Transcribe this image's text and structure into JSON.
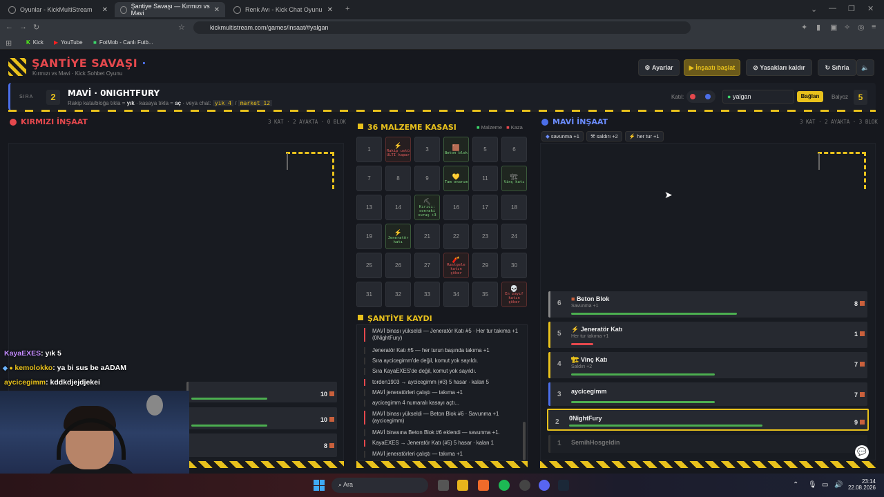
{
  "browser": {
    "tabs": [
      {
        "title": "Oyunlar - KickMultiStream",
        "active": false
      },
      {
        "title": "Şantiye Savaşı — Kırmızı vs Mavi",
        "active": true
      },
      {
        "title": "Renk Avı - Kick Chat Oyunu",
        "active": false
      }
    ],
    "url": "kickmultistream.com/games/insaat/#yalgan",
    "bookmarks": [
      "Kick",
      "YouTube",
      "FotMob - Canlı Futb..."
    ]
  },
  "header": {
    "title": "ŞANTİYE SAVAŞI",
    "subtitle": "Kırmızı vs Mavi · Kick Sohbet Oyunu",
    "buttons": {
      "settings": "Ayarlar",
      "start": "İnşaatı başlat",
      "unban": "Yasakları kaldır",
      "reset": "Sıfırla"
    }
  },
  "turn": {
    "label": "SIRA",
    "number": "2",
    "team_player": "MAVİ · 0NIGHTFURY",
    "hint_pre": "Rakip kata/bloğa tıkla = ",
    "hint_yik": "yık",
    "hint_mid": " · kasaya tıkla = ",
    "hint_ac": "aç",
    "hint_post": " · veya chat: ",
    "cmd1": "yık 4",
    "sep": "/",
    "cmd2": "market 12",
    "kat_label": "Katıl:",
    "channel_value": "yalgan",
    "connect": "Bağlan",
    "balyoz_label": "Balyoz",
    "balyoz_value": "5"
  },
  "red": {
    "title": "KIRMIZI İNŞAAT",
    "stats": "3 KAT · 2 AYAKTA · 0 BLOK",
    "floors": [
      {
        "value": "10"
      },
      {
        "value": "10"
      },
      {
        "value": "8"
      }
    ]
  },
  "blue": {
    "title": "MAVİ İNŞAAT",
    "stats": "3 KAT · 2 AYAKTA · 3 BLOK",
    "buffs": [
      "savunma +1",
      "saldırı +2",
      "her tur +1"
    ],
    "floors": [
      {
        "n": "6",
        "name": "Beton Blok",
        "sub": "Savunma +1",
        "value": "8",
        "fill": 0.6
      },
      {
        "n": "5",
        "name": "Jeneratör Katı",
        "sub": "Her tur takıma +1",
        "value": "1",
        "fill": 0.08
      },
      {
        "n": "4",
        "name": "Vinç Katı",
        "sub": "Saldırı +2",
        "value": "7",
        "fill": 0.52
      },
      {
        "n": "3",
        "name": "aycicegimm",
        "sub": "",
        "value": "7",
        "fill": 0.52
      },
      {
        "n": "2",
        "name": "0NightFury",
        "sub": "",
        "value": "9",
        "fill": 0.7
      },
      {
        "n": "1",
        "name": "SemihHosgeldin",
        "sub": "",
        "value": "",
        "fill": 0
      }
    ]
  },
  "crates": {
    "title": "36 MALZEME KASASI",
    "legend_material": "Malzeme",
    "legend_accident": "Kaza",
    "cells": [
      {
        "label": "1"
      },
      {
        "icon": "⚡",
        "label": "Rakip ustü ULTI kapar",
        "kind": "kaza"
      },
      {
        "label": "3"
      },
      {
        "icon": "🟫",
        "label": "Beton blok",
        "kind": "rev"
      },
      {
        "label": "5"
      },
      {
        "label": "6"
      },
      {
        "label": "7"
      },
      {
        "label": "8"
      },
      {
        "label": "9"
      },
      {
        "icon": "💛",
        "label": "Tam onarım",
        "kind": "rev"
      },
      {
        "label": "11"
      },
      {
        "icon": "🏗",
        "label": "Vinç katı",
        "kind": "rev"
      },
      {
        "label": "13"
      },
      {
        "label": "14"
      },
      {
        "icon": "⛏",
        "label": "Kırıcı: sonraki vuruş +3",
        "kind": "rev"
      },
      {
        "label": "16"
      },
      {
        "label": "17"
      },
      {
        "label": "18"
      },
      {
        "label": "19"
      },
      {
        "icon": "⚡",
        "label": "Jeneratör katı",
        "kind": "rev"
      },
      {
        "label": "21"
      },
      {
        "label": "22"
      },
      {
        "label": "23"
      },
      {
        "label": "24"
      },
      {
        "label": "25"
      },
      {
        "label": "26"
      },
      {
        "label": "27"
      },
      {
        "icon": "🧨",
        "label": "Rastgele katın çöker",
        "kind": "kaza"
      },
      {
        "label": "29"
      },
      {
        "label": "30"
      },
      {
        "label": "31"
      },
      {
        "label": "32"
      },
      {
        "label": "33"
      },
      {
        "label": "34"
      },
      {
        "label": "35"
      },
      {
        "icon": "💀",
        "label": "En zayıf katın çöker",
        "kind": "kaza"
      }
    ]
  },
  "log": {
    "title": "ŞANTİYE KAYDI",
    "lines": [
      "MAVİ binası yükseldi — Jeneratör Katı #5 · Her tur takıma +1 (0NightFury)",
      "Jeneratör Katı #5 — her turun başında takıma +1",
      "Sıra aycicegimm'de değil, komut yok sayıldı.",
      "Sıra KayaEXES'de değil, komut yok sayıldı.",
      "torden1903 → aycicegimm (#3) 5 hasar · kalan 5",
      "MAVİ jeneratörleri çalıştı — takıma +1",
      "aycicegimm 4 numaralı kasayı açtı...",
      "MAVİ binası yükseldi — Beton Blok #6 · Savunma +1 (aycicegimm)",
      "MAVİ binasına Beton Blok #6 eklendi — savunma +1.",
      "KayaEXES → Jeneratör Katı (#5) 5 hasar · kalan 1",
      "MAVİ jeneratörleri çalıştı — takıma +1"
    ]
  },
  "chat": [
    {
      "user": "KayaEXES",
      "msg": ": yık 5",
      "color": "#c48cff"
    },
    {
      "user": "kemolokko",
      "msg": ": ya bi sus be aADAM",
      "color": "#e8c11c"
    },
    {
      "user": "aycicegimm",
      "msg": ": kddkdjejdjekei",
      "color": "#e8c11c"
    }
  ],
  "taskbar": {
    "search": "Ara",
    "time": "23:14",
    "date": "22.08.2026"
  }
}
